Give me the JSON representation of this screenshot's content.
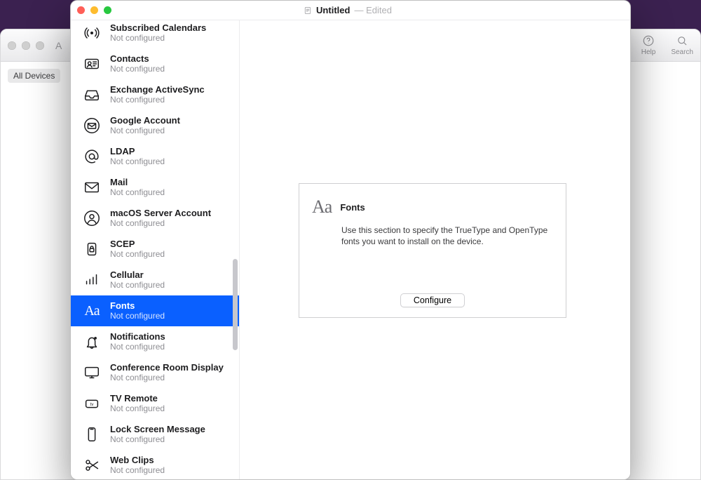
{
  "background_window": {
    "title_letter": "A",
    "toolbar": {
      "help_label": "Help",
      "search_label": "Search"
    },
    "devices_tag": "All Devices"
  },
  "front_window": {
    "doc_title": "Untitled",
    "doc_state_sep": " — ",
    "doc_state": "Edited"
  },
  "sidebar": {
    "items": [
      {
        "id": "subscribed-calendars",
        "title": "Subscribed Calendars",
        "sub": "Not configured",
        "icon": "broadcast",
        "clipped": true
      },
      {
        "id": "contacts",
        "title": "Contacts",
        "sub": "Not configured",
        "icon": "contact-card"
      },
      {
        "id": "exchange-activesync",
        "title": "Exchange ActiveSync",
        "sub": "Not configured",
        "icon": "inbox"
      },
      {
        "id": "google-account",
        "title": "Google Account",
        "sub": "Not configured",
        "icon": "envelope-circle"
      },
      {
        "id": "ldap",
        "title": "LDAP",
        "sub": "Not configured",
        "icon": "at"
      },
      {
        "id": "mail",
        "title": "Mail",
        "sub": "Not configured",
        "icon": "envelope"
      },
      {
        "id": "macos-server",
        "title": "macOS Server Account",
        "sub": "Not configured",
        "icon": "person-circle"
      },
      {
        "id": "scep",
        "title": "SCEP",
        "sub": "Not configured",
        "icon": "lock-device"
      },
      {
        "id": "cellular",
        "title": "Cellular",
        "sub": "Not configured",
        "icon": "cellular-bars"
      },
      {
        "id": "fonts",
        "title": "Fonts",
        "sub": "Not configured",
        "icon": "aa",
        "selected": true
      },
      {
        "id": "notifications",
        "title": "Notifications",
        "sub": "Not configured",
        "icon": "bell"
      },
      {
        "id": "conference-room",
        "title": "Conference Room Display",
        "sub": "Not configured",
        "icon": "display"
      },
      {
        "id": "tv-remote",
        "title": "TV Remote",
        "sub": "Not configured",
        "icon": "appletv"
      },
      {
        "id": "lock-screen",
        "title": "Lock Screen Message",
        "sub": "Not configured",
        "icon": "phone"
      },
      {
        "id": "web-clips",
        "title": "Web Clips",
        "sub": "Not configured",
        "icon": "scissors"
      }
    ]
  },
  "content_panel": {
    "icon_label": "Aa",
    "title": "Fonts",
    "description": "Use this section to specify the TrueType and OpenType fonts you want to install on the device.",
    "configure_button": "Configure"
  }
}
